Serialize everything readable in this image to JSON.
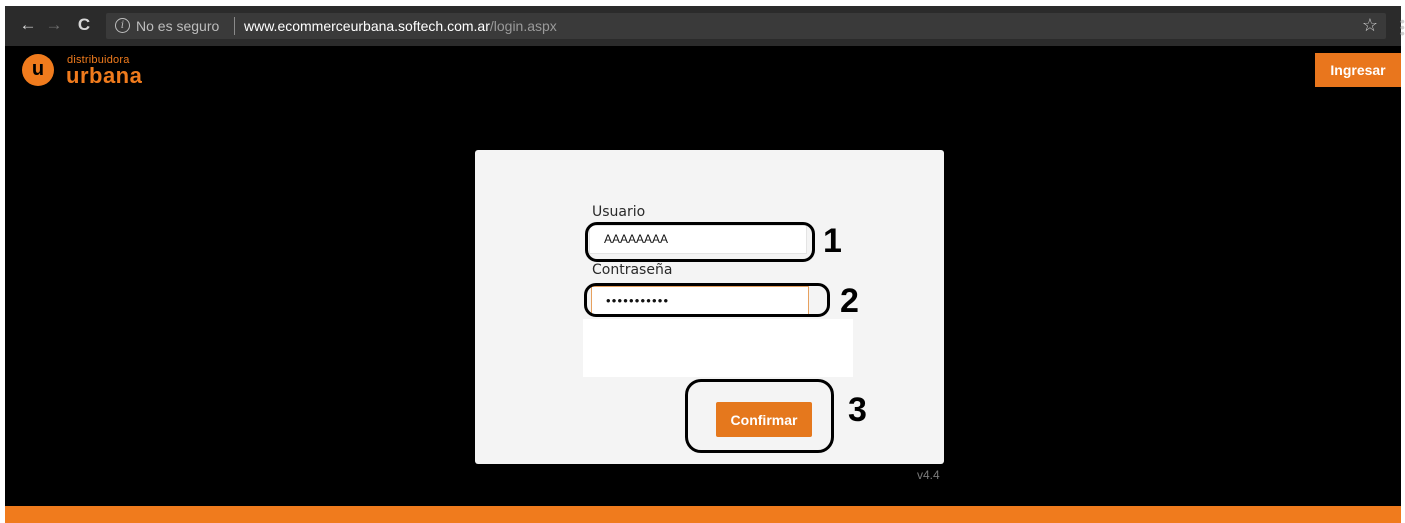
{
  "browser": {
    "back_icon": "arrow-left-icon",
    "forward_icon": "arrow-right-icon",
    "reload_icon": "reload-icon",
    "security_icon": "info-icon",
    "security_text": "No es seguro",
    "url_host": "www.ecommerceurbana.softech.com.ar",
    "url_path": "/login.aspx",
    "bookmark_icon": "star-icon",
    "menu_icon": "kebab-menu-icon"
  },
  "header": {
    "logo": {
      "small_text": "distribuidora",
      "main_text": "urbana",
      "mark_letter": "u"
    },
    "login_button": "Ingresar"
  },
  "login": {
    "username_label": "Usuario",
    "username_value": "AAAAAAAA",
    "password_label": "Contraseña",
    "password_value": "•••••••••••",
    "confirm_button": "Confirmar"
  },
  "annotations": [
    "1",
    "2",
    "3"
  ],
  "version": "v4.4",
  "colors": {
    "accent": "#f07b1d",
    "background": "#000000",
    "panel": "#f4f4f4"
  }
}
